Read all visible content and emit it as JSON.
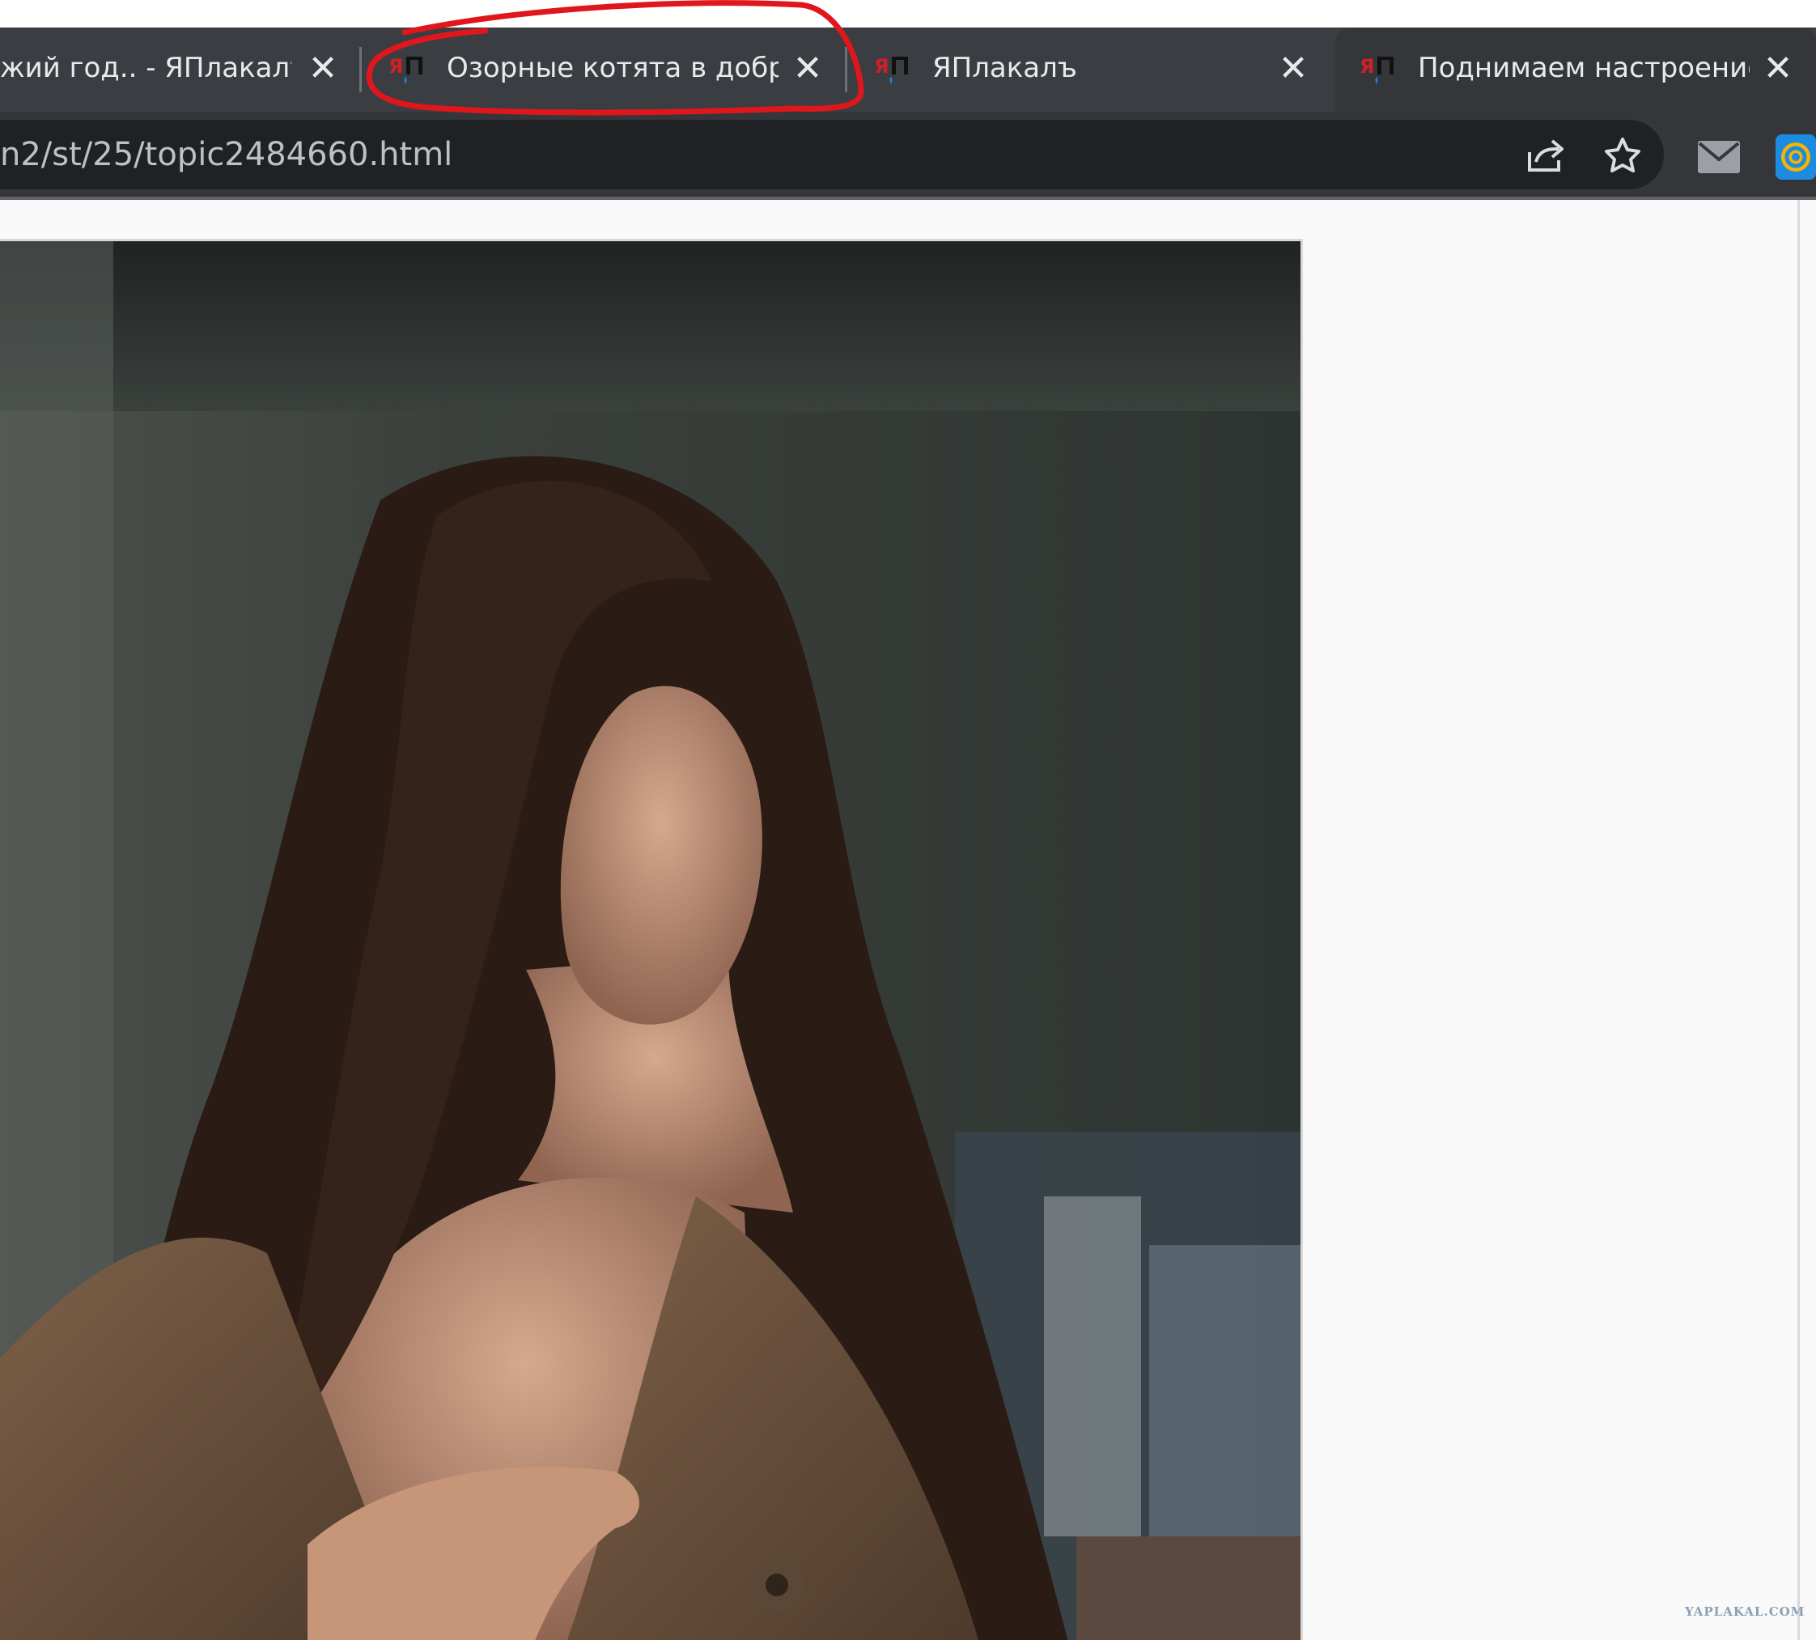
{
  "browser": {
    "tabs": [
      {
        "title": "жий год.. - ЯПлакалъ",
        "close": "✕"
      },
      {
        "title": "Озорные котята в добры",
        "close": "✕",
        "circled": true
      },
      {
        "title": "ЯПлакалъ",
        "close": "✕"
      },
      {
        "title": "Поднимаем настроение",
        "close": "✕"
      }
    ],
    "url": "n2/st/25/topic2484660.html",
    "icons": [
      "share-icon",
      "star-icon",
      "mail-icon",
      "at-sign-icon"
    ]
  },
  "page": {
    "image": "photo of dark-haired woman in trench coat",
    "watermark": "YAPLAKAL.COM"
  },
  "colors": {
    "tabbar": "#3a3d41",
    "toolbar": "#35363a",
    "omnibox": "#202124",
    "annotation_red": "#e0161d",
    "favicon_red": "#d21f26"
  }
}
